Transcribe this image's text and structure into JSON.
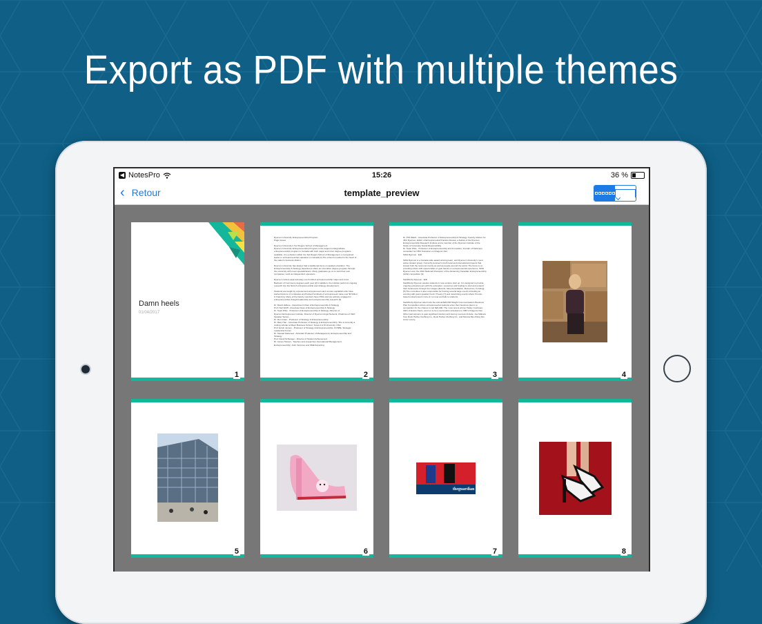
{
  "headline": "Export as PDF with multiple themes",
  "status": {
    "app": "NotesPro",
    "time": "15:26",
    "battery": "36 %"
  },
  "nav": {
    "back_label": "Retour",
    "title": "template_preview"
  },
  "cover": {
    "title": "Damn heels",
    "date": "01/04/2017"
  },
  "pages": [
    {
      "number": "1"
    },
    {
      "number": "2",
      "text": "Ryerson University Entrepreneurship Program\nPage Issues\n\nRyerson University's Ted Rogers School of Management\nRyerson University Entrepreneurship Program is the largest undergraduate\nentrepreneurship program in Canada with both major and minor degree programs\navailable. It is a division within the Ted Rogers School of Management, a recognized\nleader in entrepreneurship education in Canada [1] The school is located in the heart of\nthe nation's business district.\n\nRyerson University has always had a traditional focus on applied education. The\nEntrepreneurship & Strategy department offers an innovative degree program through\nthe university with novel specializations. Many graduates go on to start their own\ncompanies, work as independent operators...\n\nRyerson confers approximately one hundred entrepreneurship major and minor\nBachelor of Commerce degrees each year [2] In addition, the institute performs ongoing\nresearch into the field of entrepreneurship and strategy development.\n\nStudents are taught by experienced entrepreneurs and venture capitalists who have\nstarted dozens of companies and helped hundreds of entrepreneurs raise over $2 billion\nin financing. Many of the faculty members have PhDs and are actively engaged in\nentrepreneurship thought leadership and entrepreneurship research [4].\n\nDr. David Valliere - Department Chair of Entrepreneurship & Strategy\nProf. Neil Wolff - Associate Dean of Entrepreneurship & Strategy\nDr. Sean Wise - Professor of Entrepreneurship & Strategy, Director of\nRyerson Entrepreneur Institute, Director of Ryerson Angel Network, Chairman of CEO\nSpeaker Series...\nDr. Ron Grant - Professor of Strategy & Entrepreneurship\nDr. Mary Han - Associate Professor of Strategy & Entrepreneurship. She is currently a\nvisiting scholar at Mays Business School, Texas A & M University, USA\nProf. Erwin Jensen - Professor of Strategy & Entrepreneurship, CCSBE, Strategic\nLeadership Forum\nDr. Stewart Melamed - Assistant Professor of Management, Entrepreneurship and\nStrategy\nProf. David Schlanger - Director of Student Achievement\nDr. James Tassan - Teaches and researches International Management,\nEntrepreneurship, Joint Ventures and SME Exporting"
    },
    {
      "number": "3",
      "text": "Dr. Phil Walsh - Associate Professor of Entrepreneurship & Strategy. Faculty Advisor for\nJDC Ryerson. Editor of Entrepreneurial Practice Review, a Fellow of the Ryerson\nEntrepreneurship Research Institute and a member of the Ryerson Institute of the\nStudy of Corporate Social Responsibility\nDr. Sean Wise - Professor of Entrepreneurship and Innovation, founder of NetGrays,\nconsultant for CBC Television on Dragons' Den\nSIFE Ryerson : Edit\n\nSIFE Ryerson is a Canada wide award winning team, and Ryerson University's most\nactive student group. Currently involved in both local and international projects that\nimpact both the local community as well as people around the world. The focus is on\nproviding others with opportunities to gain hands on entrepreneurial experience. SIFE\nRyerson won the 2010 National Champion of the Advancing Canadian Entrepreneurship\n(ACE) competition [4]\n\nStartMeUp Ryerson : Edit\nStartMeUp Ryerson assists students in new venture start up. It is designed to provide\nongoing entrepreneurs with the education, resources and funding to start and expand\ntheir businesses through four stages (Events, Idea Consultation, Resources, Funding)\n[5] The committee is also responsible for hosting several large events including an\nevening with guest speaker Kevin O'Leary [7] and networking events where Toronto-\nbased entrepreneurs come in to meet and talk to students.\n\nStartMeUp Ryerson also hosts the annual $20,000 Sleight Communications Business\nPlan Competition where entrepreneurial students enter their business plan in a\ncompetition for the chance to win $20,000. The most recent winner Hailey Cushman,\nCEO of Evans Heels, went on to be a successful contestant on CBC's Dragons' Den.\nOther past winners to gain significant traction and start up success include: Joe Mahara\nfrom Rock Harbor Clothing Co., Rock Harbor Clothing Co., and Monica Mei-Ching Kim,\nAnne Luxury."
    },
    {
      "number": "4"
    },
    {
      "number": "5"
    },
    {
      "number": "6"
    },
    {
      "number": "7",
      "caption": "theguardian"
    },
    {
      "number": "8"
    }
  ],
  "colors": {
    "background": "#0f5f86",
    "accent": "#14b79b",
    "ios_blue": "#1e7be6"
  },
  "icons": [
    "grid-icon",
    "bookmark-icon",
    "wifi-icon",
    "battery-icon",
    "back-chevron-icon"
  ]
}
